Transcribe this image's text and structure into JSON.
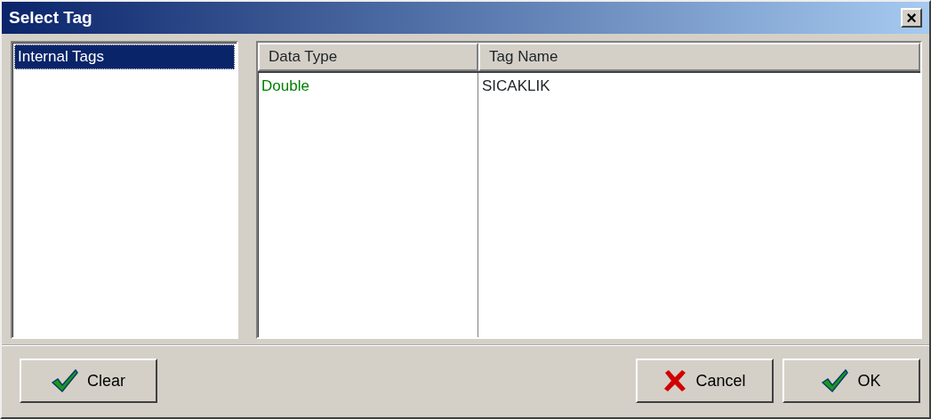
{
  "window": {
    "title": "Select Tag",
    "close": "×"
  },
  "tag_groups": [
    {
      "label": "Internal Tags",
      "selected": true
    }
  ],
  "table": {
    "columns": [
      "Data Type",
      "Tag Name"
    ],
    "rows": [
      {
        "cells": [
          "Double",
          "SICAKLIK"
        ]
      }
    ]
  },
  "buttons": [
    {
      "label": "Clear",
      "kind": "check"
    },
    {
      "label": "Cancel",
      "kind": "cross"
    },
    {
      "label": "OK",
      "kind": "check"
    }
  ]
}
